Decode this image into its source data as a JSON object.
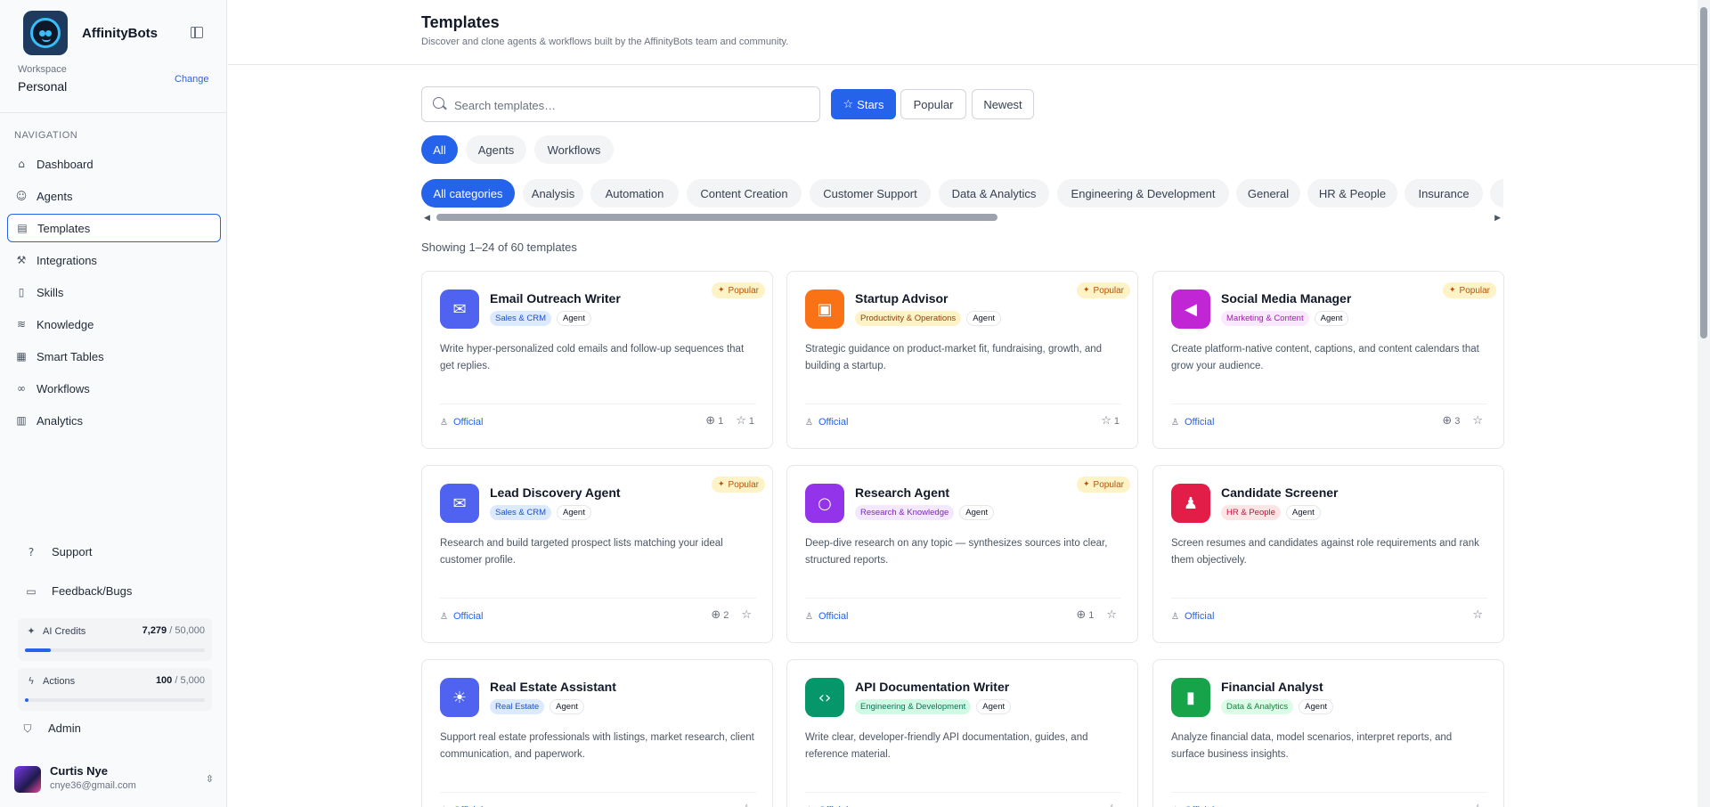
{
  "brand": {
    "name": "AffinityBots"
  },
  "workspace": {
    "label": "Workspace",
    "value": "Personal",
    "change": "Change"
  },
  "nav": {
    "title": "NAVIGATION",
    "items": [
      {
        "label": "Dashboard",
        "icon": "home-icon"
      },
      {
        "label": "Agents",
        "icon": "bot-icon"
      },
      {
        "label": "Templates",
        "icon": "templates-icon"
      },
      {
        "label": "Integrations",
        "icon": "wrench-icon"
      },
      {
        "label": "Skills",
        "icon": "file-code-icon"
      },
      {
        "label": "Knowledge",
        "icon": "database-icon"
      },
      {
        "label": "Smart Tables",
        "icon": "table-icon"
      },
      {
        "label": "Workflows",
        "icon": "workflow-icon"
      },
      {
        "label": "Analytics",
        "icon": "chart-icon"
      }
    ]
  },
  "footer": {
    "support": "Support",
    "feedback": "Feedback/Bugs",
    "ai_credits": {
      "label": "AI Credits",
      "used": "7,279",
      "total": "/ 50,000",
      "fraction": 0.146
    },
    "actions": {
      "label": "Actions",
      "used": "100",
      "total": "/ 5,000",
      "fraction": 0.02
    },
    "admin": "Admin"
  },
  "user": {
    "name": "Curtis Nye",
    "email": "cnye36@gmail.com"
  },
  "header": {
    "title": "Templates",
    "subtitle": "Discover and clone agents & workflows built by the AffinityBots team and community."
  },
  "search": {
    "placeholder": "Search templates…",
    "value": ""
  },
  "sort": {
    "stars": "Stars",
    "popular": "Popular",
    "newest": "Newest"
  },
  "types": [
    "All",
    "Agents",
    "Workflows"
  ],
  "categories": [
    "All categories",
    "Analysis",
    "Automation",
    "Content Creation",
    "Customer Support",
    "Data & Analytics",
    "Engineering & Development",
    "General",
    "HR & People",
    "Insurance"
  ],
  "showing": "Showing 1–24 of 60 templates",
  "popular_label": "Popular",
  "official_label": "Official",
  "cards": [
    {
      "name": "Email Outreach Writer",
      "category": "Sales & CRM",
      "type": "Agent",
      "desc": "Write hyper-personalized cold emails and follow-up sequences that get replies.",
      "popular": true,
      "clones": "1",
      "stars": "1",
      "color": "#4f63f0",
      "icon": "handshake-icon",
      "glyph": "✉",
      "tagbg": "#dbeafe",
      "tagfg": "#1d4ed8"
    },
    {
      "name": "Startup Advisor",
      "category": "Productivity & Operations",
      "type": "Agent",
      "desc": "Strategic guidance on product-market fit, fundraising, growth, and building a startup.",
      "popular": true,
      "clones": "",
      "stars": "1",
      "color": "#f97316",
      "icon": "briefcase-icon",
      "glyph": "▣",
      "tagbg": "#fef3c7",
      "tagfg": "#92400e"
    },
    {
      "name": "Social Media Manager",
      "category": "Marketing & Content",
      "type": "Agent",
      "desc": "Create platform-native content, captions, and content calendars that grow your audience.",
      "popular": true,
      "clones": "3",
      "stars": "",
      "color": "#c026d3",
      "icon": "megaphone-icon",
      "glyph": "◀",
      "tagbg": "#fae8ff",
      "tagfg": "#a21caf"
    },
    {
      "name": "Lead Discovery Agent",
      "category": "Sales & CRM",
      "type": "Agent",
      "desc": "Research and build targeted prospect lists matching your ideal customer profile.",
      "popular": true,
      "clones": "2",
      "stars": "",
      "color": "#4f63f0",
      "icon": "handshake-icon",
      "glyph": "✉",
      "tagbg": "#dbeafe",
      "tagfg": "#1d4ed8"
    },
    {
      "name": "Research Agent",
      "category": "Research & Knowledge",
      "type": "Agent",
      "desc": "Deep-dive research on any topic — synthesizes sources into clear, structured reports.",
      "popular": true,
      "clones": "1",
      "stars": "",
      "color": "#9333ea",
      "icon": "search-icon",
      "glyph": "○",
      "tagbg": "#f3e8ff",
      "tagfg": "#7e22ce"
    },
    {
      "name": "Candidate Screener",
      "category": "HR & People",
      "type": "Agent",
      "desc": "Screen resumes and candidates against role requirements and rank them objectively.",
      "popular": false,
      "clones": "",
      "stars": "",
      "color": "#e11d48",
      "icon": "users-icon",
      "glyph": "♟",
      "tagbg": "#ffe4e6",
      "tagfg": "#be123c"
    },
    {
      "name": "Real Estate Assistant",
      "category": "Real Estate",
      "type": "Agent",
      "desc": "Support real estate professionals with listings, market research, client communication, and paperwork.",
      "popular": false,
      "clones": "",
      "stars": "",
      "color": "#4f63f0",
      "icon": "lightbulb-icon",
      "glyph": "☀",
      "tagbg": "#dbeafe",
      "tagfg": "#1d4ed8"
    },
    {
      "name": "API Documentation Writer",
      "category": "Engineering & Development",
      "type": "Agent",
      "desc": "Write clear, developer-friendly API documentation, guides, and reference material.",
      "popular": false,
      "clones": "",
      "stars": "",
      "color": "#059669",
      "icon": "code-icon",
      "glyph": "‹›",
      "tagbg": "#d1fae5",
      "tagfg": "#047857"
    },
    {
      "name": "Financial Analyst",
      "category": "Data & Analytics",
      "type": "Agent",
      "desc": "Analyze financial data, model scenarios, interpret reports, and surface business insights.",
      "popular": false,
      "clones": "",
      "stars": "",
      "color": "#16a34a",
      "icon": "bar-chart-icon",
      "glyph": "▮",
      "tagbg": "#dcfce7",
      "tagfg": "#15803d"
    }
  ]
}
